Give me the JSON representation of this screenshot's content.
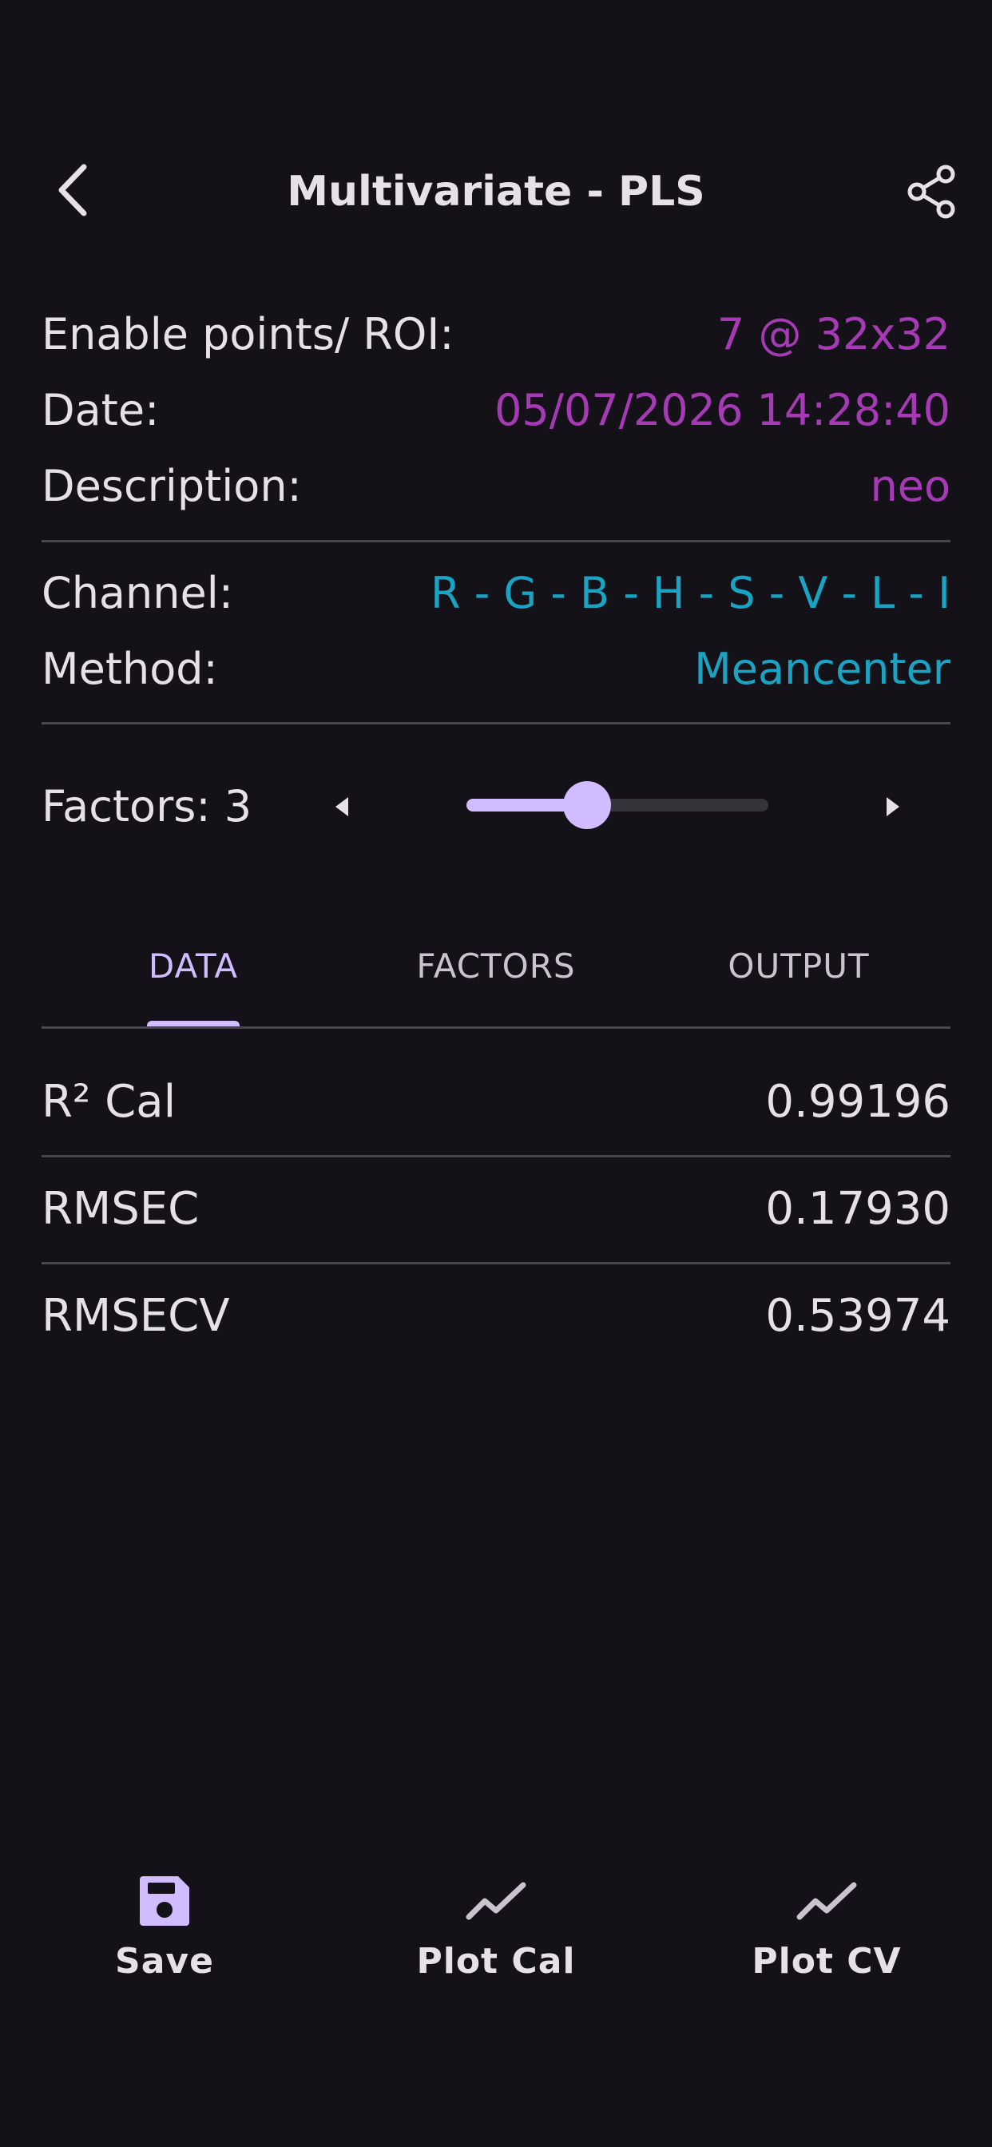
{
  "header": {
    "title": "Multivariate - PLS"
  },
  "info": {
    "enable_points_label": "Enable points/ ROI:",
    "enable_points_value": "7 @ 32x32",
    "date_label": "Date:",
    "date_value": "05/07/2026 14:28:40",
    "description_label": "Description:",
    "description_value": "neo",
    "channel_label": "Channel:",
    "channel_value": "R - G - B - H - S - V - L - I",
    "method_label": "Method:",
    "method_value": "Meancenter"
  },
  "factors": {
    "label": "Factors: 3",
    "value": 3,
    "slider_fraction": 0.4
  },
  "tabs": [
    {
      "label": "DATA",
      "active": true
    },
    {
      "label": "FACTORS",
      "active": false
    },
    {
      "label": "OUTPUT",
      "active": false
    }
  ],
  "metrics": [
    {
      "label": "R² Cal",
      "value": "0.99196"
    },
    {
      "label": "RMSEC",
      "value": "0.17930"
    },
    {
      "label": "RMSECV",
      "value": "0.53974"
    }
  ],
  "actions": {
    "save": {
      "label": "Save",
      "icon": "floppy-disk-icon"
    },
    "plot_cal": {
      "label": "Plot Cal",
      "icon": "line-chart-icon"
    },
    "plot_cv": {
      "label": "Plot CV",
      "icon": "line-chart-icon"
    }
  },
  "colors": {
    "background": "#141218",
    "accent": "#d0bcff",
    "value_purple": "#a63ab5",
    "value_cyan": "#1aa3c2"
  }
}
